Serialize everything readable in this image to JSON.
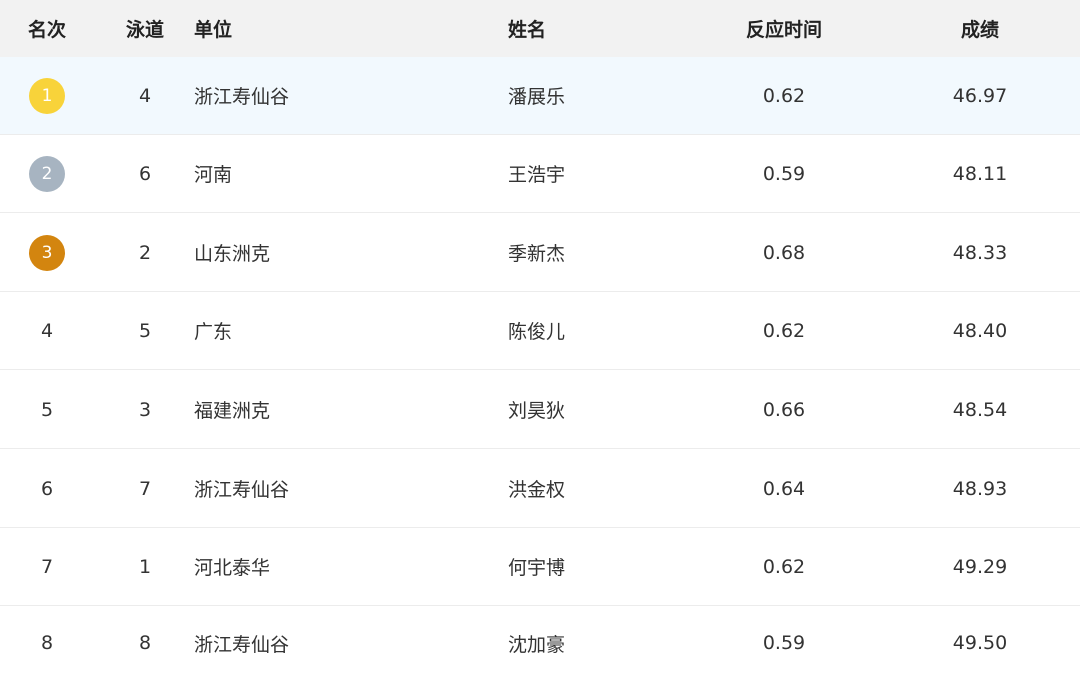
{
  "header": {
    "rank": "名次",
    "lane": "泳道",
    "unit": "单位",
    "name": "姓名",
    "reaction": "反应时间",
    "result": "成绩"
  },
  "medal_colors": {
    "gold": "#f8d33a",
    "silver": "#a7b4c1",
    "bronze": "#d3850f"
  },
  "highlight_color": "#f2f9fe",
  "rows": [
    {
      "rank": "1",
      "medal": "gold",
      "lane": "4",
      "unit": "浙江寿仙谷",
      "name": "潘展乐",
      "reaction": "0.62",
      "result": "46.97"
    },
    {
      "rank": "2",
      "medal": "silver",
      "lane": "6",
      "unit": "河南",
      "name": "王浩宇",
      "reaction": "0.59",
      "result": "48.11"
    },
    {
      "rank": "3",
      "medal": "bronze",
      "lane": "2",
      "unit": "山东洲克",
      "name": "季新杰",
      "reaction": "0.68",
      "result": "48.33"
    },
    {
      "rank": "4",
      "medal": "",
      "lane": "5",
      "unit": "广东",
      "name": "陈俊儿",
      "reaction": "0.62",
      "result": "48.40"
    },
    {
      "rank": "5",
      "medal": "",
      "lane": "3",
      "unit": "福建洲克",
      "name": "刘昊狄",
      "reaction": "0.66",
      "result": "48.54"
    },
    {
      "rank": "6",
      "medal": "",
      "lane": "7",
      "unit": "浙江寿仙谷",
      "name": "洪金权",
      "reaction": "0.64",
      "result": "48.93"
    },
    {
      "rank": "7",
      "medal": "",
      "lane": "1",
      "unit": "河北泰华",
      "name": "何宇博",
      "reaction": "0.62",
      "result": "49.29"
    },
    {
      "rank": "8",
      "medal": "",
      "lane": "8",
      "unit": "浙江寿仙谷",
      "name": "沈加豪",
      "reaction": "0.59",
      "result": "49.50"
    }
  ]
}
